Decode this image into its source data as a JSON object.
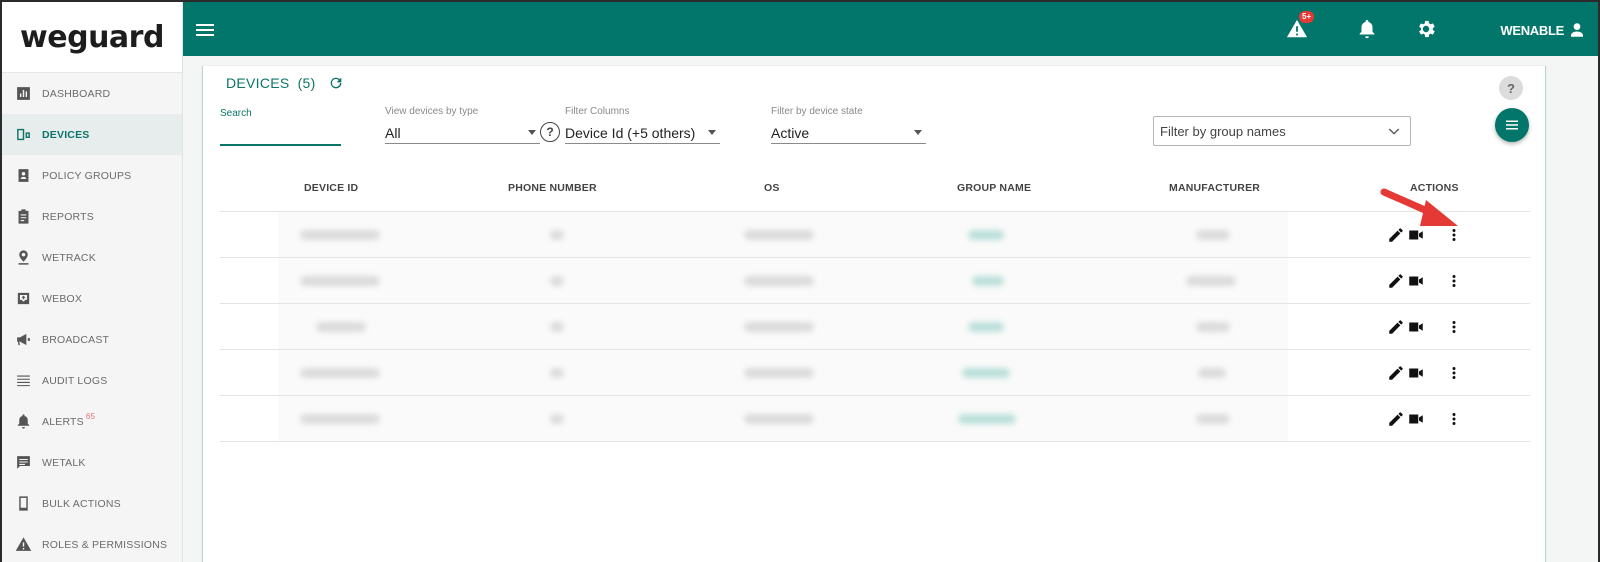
{
  "app": {
    "logo": "weguard"
  },
  "sidebar": {
    "items": [
      {
        "label": "DASHBOARD",
        "icon": "dashboard-icon"
      },
      {
        "label": "DEVICES",
        "icon": "devices-icon",
        "active": true
      },
      {
        "label": "POLICY GROUPS",
        "icon": "policy-groups-icon"
      },
      {
        "label": "REPORTS",
        "icon": "reports-icon"
      },
      {
        "label": "WETRACK",
        "icon": "location-pin-icon"
      },
      {
        "label": "WEBOX",
        "icon": "inbox-icon"
      },
      {
        "label": "BROADCAST",
        "icon": "megaphone-icon"
      },
      {
        "label": "AUDIT LOGS",
        "icon": "list-icon"
      },
      {
        "label": "ALERTS",
        "icon": "alert-bell-icon",
        "badge": "65"
      },
      {
        "label": "WETALK",
        "icon": "chat-icon"
      },
      {
        "label": "BULK ACTIONS",
        "icon": "phone-icon"
      },
      {
        "label": "ROLES & PERMISSIONS",
        "icon": "warning-icon"
      }
    ]
  },
  "topbar": {
    "warning_badge": "5+",
    "user_name": "WENABLE"
  },
  "page": {
    "title": "DEVICES",
    "count": "(5)",
    "help": "?"
  },
  "filters": {
    "search_label": "Search",
    "search_value": "",
    "search_help": "?",
    "type_label": "View devices by type",
    "type_value": "All",
    "columns_label": "Filter Columns",
    "columns_value": "Device Id (+5 others)",
    "state_label": "Filter by device state",
    "state_value": "Active",
    "group_placeholder": "Filter by group names"
  },
  "table": {
    "headers": [
      "DEVICE ID",
      "PHONE NUMBER",
      "OS",
      "GROUP NAME",
      "MANUFACTURER",
      "ACTIONS"
    ],
    "row_count": 5
  },
  "colors": {
    "brand": "#02766a",
    "accent": "#0d7468",
    "annotation_arrow": "#e53935"
  }
}
